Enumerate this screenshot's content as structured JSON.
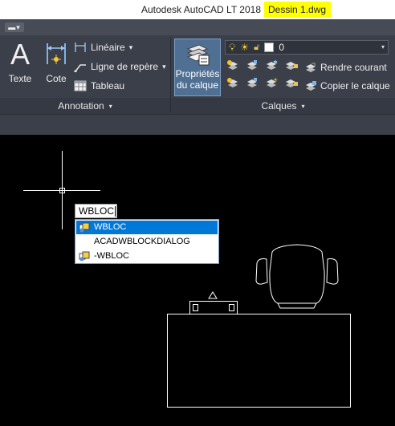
{
  "window": {
    "app_title": "Autodesk AutoCAD LT 2018",
    "file_name": "Dessin 1.dwg"
  },
  "quick_access": {
    "menu_glyph": "▬▾"
  },
  "ribbon": {
    "annotation": {
      "text_label": "Texte",
      "text_glyph": "A",
      "dimension_label": "Cote",
      "linear_label": "Linéaire",
      "leader_label": "Ligne de repère",
      "table_label": "Tableau",
      "panel_title": "Annotation"
    },
    "layers": {
      "properties_label_line1": "Propriétés",
      "properties_label_line2": "du calque",
      "current_layer": "0",
      "make_current_label": "Rendre courant",
      "copy_label": "Copier le calque",
      "panel_title": "Calques"
    },
    "dropdown_glyph": "▾"
  },
  "command_line": {
    "input_value": "WBLOC"
  },
  "autocomplete": {
    "items": [
      {
        "label": "WBLOC",
        "selected": true,
        "has_icon": true
      },
      {
        "label": "ACADWBLOCKDIALOG",
        "selected": false,
        "has_icon": false
      },
      {
        "label": "-WBLOC",
        "selected": false,
        "has_icon": true
      }
    ]
  },
  "colors": {
    "title_highlight": "#ffff00",
    "ribbon_bg": "#3b3f49",
    "selection_blue": "#0078d7",
    "canvas_bg": "#000000",
    "drawing_lines": "#ffffff"
  }
}
